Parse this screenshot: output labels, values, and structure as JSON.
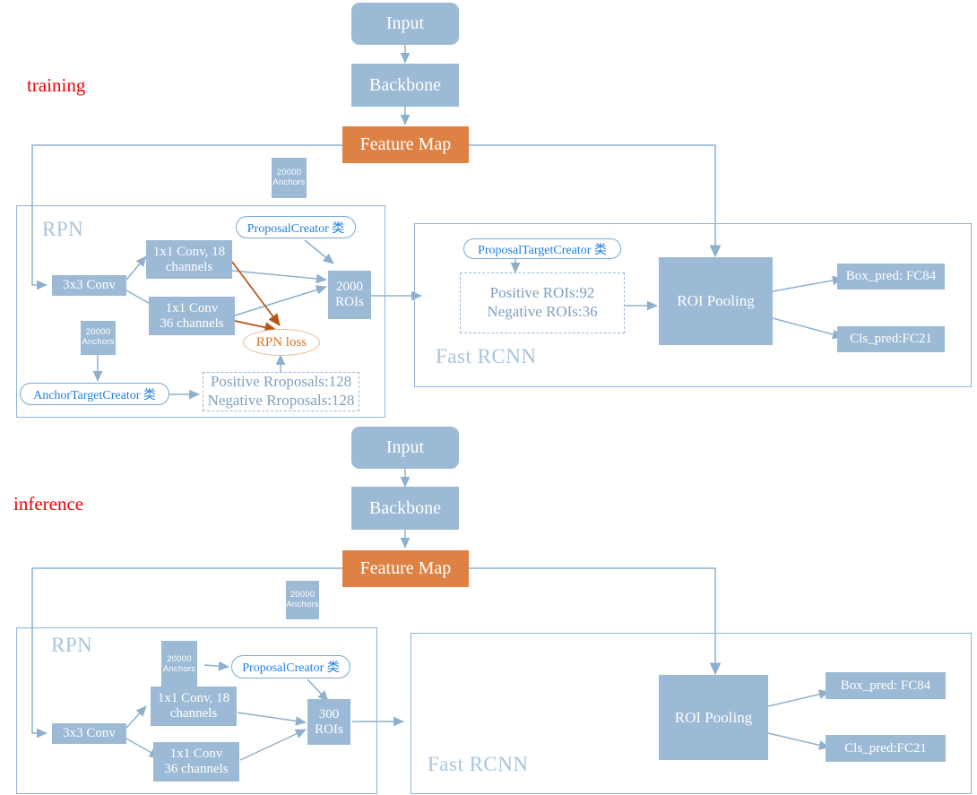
{
  "diagram": {
    "title": "Faster R-CNN training and inference pipeline",
    "colors": {
      "node_blue": "#9cbad6",
      "feature_map_orange": "#dd8244",
      "group_border": "#8fb4d9",
      "group_label": "#a8c4de",
      "class_text_blue": "#1f7fe0",
      "loss_orange": "#d4762c",
      "phase_label_red": "#f2000a",
      "arrow_gray_blue": "#8fb0cc",
      "loss_arrow_brown": "#b5551a"
    }
  },
  "training": {
    "phase_label": "training",
    "input": "Input",
    "backbone": "Backbone",
    "feature_map": "Feature Map",
    "anchors_top": {
      "line1": "20000",
      "line2": "Anchors"
    },
    "rpn": {
      "group_label": "RPN",
      "conv3x3": "3x3 Conv",
      "conv1x1_cls": {
        "line1": "1x1 Conv, 18",
        "line2": "channels"
      },
      "conv1x1_reg": {
        "line1": "1x1 Conv",
        "line2": "36 channels"
      },
      "proposal_creator": "ProposalCreator 类",
      "rois": {
        "line1": "2000",
        "line2": "ROIs"
      },
      "rpn_loss": "RPN loss",
      "anchors": {
        "line1": "20000",
        "line2": "Anchors"
      },
      "anchor_target_creator": "AnchorTargetCreator 类",
      "proposals_box": {
        "line1": "Positive Rroposals:128",
        "line2": "Negative Rroposals:128"
      }
    },
    "fast_rcnn": {
      "group_label": "Fast RCNN",
      "proposal_target_creator": "ProposalTargetCreator 类",
      "rois_box": {
        "line1": "Positive ROIs:92",
        "line2": "Negative ROIs:36"
      },
      "roi_pooling": "ROI Pooling",
      "box_pred": "Box_pred: FC84",
      "cls_pred": "Cls_pred:FC21"
    }
  },
  "inference": {
    "phase_label": "inference",
    "input": "Input",
    "backbone": "Backbone",
    "feature_map": "Feature Map",
    "anchors_top": {
      "line1": "20000",
      "line2": "Anchors"
    },
    "rpn": {
      "group_label": "RPN",
      "conv3x3": "3x3 Conv",
      "conv1x1_cls": {
        "line1": "1x1 Conv, 18",
        "line2": "channels"
      },
      "conv1x1_reg": {
        "line1": "1x1 Conv",
        "line2": "36 channels"
      },
      "anchors": {
        "line1": "20000",
        "line2": "Anchors"
      },
      "proposal_creator": "ProposalCreator 类",
      "rois": {
        "line1": "300",
        "line2": "ROIs"
      }
    },
    "fast_rcnn": {
      "group_label": "Fast RCNN",
      "roi_pooling": "ROI Pooling",
      "box_pred": "Box_pred: FC84",
      "cls_pred": "Cls_pred:FC21"
    }
  }
}
